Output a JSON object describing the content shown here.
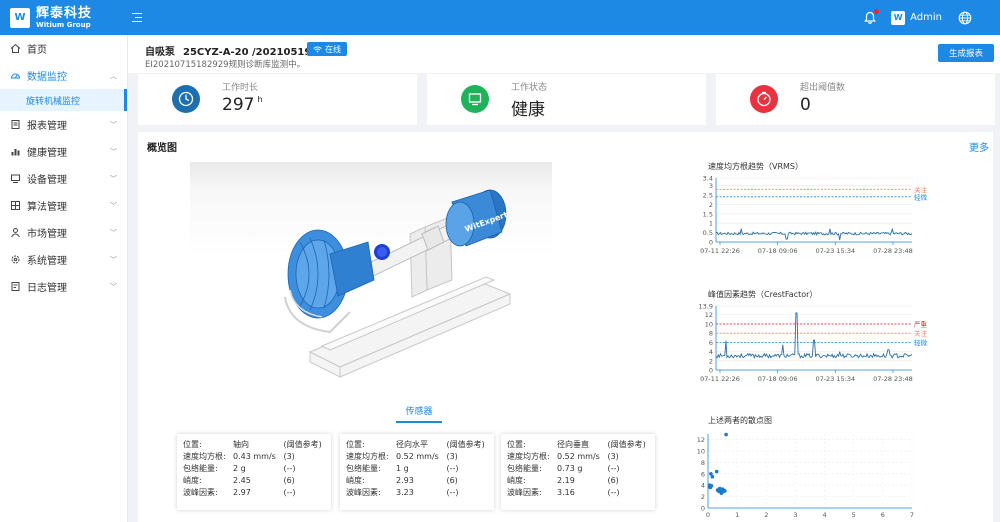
{
  "header": {
    "logo_mark": "W",
    "logo_cn": "辉泰科技",
    "logo_en": "Witium Group",
    "avatar_letter": "W",
    "user_name": "Admin"
  },
  "sidebar": {
    "items": [
      {
        "label": "首页",
        "icon": "home-icon"
      },
      {
        "label": "数据监控",
        "icon": "dashboard-icon",
        "open": true
      },
      {
        "label": "报表管理",
        "icon": "report-icon"
      },
      {
        "label": "健康管理",
        "icon": "bar-chart-icon"
      },
      {
        "label": "设备管理",
        "icon": "device-icon"
      },
      {
        "label": "算法管理",
        "icon": "algorithm-icon"
      },
      {
        "label": "市场管理",
        "icon": "market-icon"
      },
      {
        "label": "系统管理",
        "icon": "settings-icon"
      },
      {
        "label": "日志管理",
        "icon": "log-icon"
      }
    ],
    "sub_item": "旋转机械监控"
  },
  "device": {
    "name": "自吸泵",
    "id": "25CYZ-A-20 /20210519",
    "status": "在线",
    "description": "EI20210715182929规则诊断库监测中。",
    "report_button": "生成报表"
  },
  "stats": [
    {
      "label": "工作时长",
      "value": "297",
      "unit": "h",
      "color": "#1e6fb0",
      "icon": "clock-icon"
    },
    {
      "label": "工作状态",
      "value": "健康",
      "unit": "",
      "color": "#1fb25a",
      "icon": "monitor-icon"
    },
    {
      "label": "超出阈值数",
      "value": "0",
      "unit": "",
      "color": "#e8323f",
      "icon": "timer-icon"
    }
  ],
  "overview": {
    "title": "概览图",
    "more": "更多",
    "sensor_tab": "传感器",
    "model_label": "WitExpert"
  },
  "sensors": [
    {
      "rows": [
        [
          "位置:",
          "轴向",
          "(阈值参考)"
        ],
        [
          "速度均方根:",
          "0.43 mm/s",
          "(3)"
        ],
        [
          "包络能量:",
          "2 g",
          "(--)"
        ],
        [
          "峭度:",
          "2.45",
          "(6)"
        ],
        [
          "波峰因素:",
          "2.97",
          "(--)"
        ]
      ]
    },
    {
      "rows": [
        [
          "位置:",
          "径向水平",
          "(阈值参考)"
        ],
        [
          "速度均方根:",
          "0.52 mm/s",
          "(3)"
        ],
        [
          "包络能量:",
          "1 g",
          "(--)"
        ],
        [
          "峭度:",
          "2.93",
          "(6)"
        ],
        [
          "波峰因素:",
          "3.23",
          "(--)"
        ]
      ]
    },
    {
      "rows": [
        [
          "位置:",
          "径向垂直",
          "(阈值参考)"
        ],
        [
          "速度均方根:",
          "0.52 mm/s",
          "(3)"
        ],
        [
          "包络能量:",
          "0.73 g",
          "(--)"
        ],
        [
          "峭度:",
          "2.19",
          "(6)"
        ],
        [
          "波峰因素:",
          "3.16",
          "(--)"
        ]
      ]
    }
  ],
  "chart_data": [
    {
      "type": "line",
      "title": "速度均方根趋势（VRMS）",
      "yticks": [
        0,
        0.5,
        1,
        1.5,
        2,
        2.5,
        3,
        3.4
      ],
      "ylim": [
        0,
        3.4
      ],
      "xticks": [
        "07-11 22:26",
        "07-18 09:06",
        "07-23 15:34",
        "07-28 23:48"
      ],
      "thresholds": [
        {
          "label": "关注",
          "value": 2.8,
          "color": "#f4845f"
        },
        {
          "label": "轻微",
          "value": 2.4,
          "color": "#1e88e5"
        }
      ],
      "series": [
        {
          "baseline": 0.45,
          "noise": 0.07,
          "spikes": [
            [
              0.13,
              0.7
            ],
            [
              0.36,
              0.15
            ],
            [
              0.58,
              0.7
            ],
            [
              0.63,
              0.1
            ],
            [
              0.9,
              0.68
            ]
          ]
        }
      ]
    },
    {
      "type": "line",
      "title": "峰值因素趋势（CrestFactor）",
      "yticks": [
        0,
        2,
        4,
        6,
        8,
        10,
        12,
        13.9
      ],
      "ylim": [
        0,
        13.9
      ],
      "xticks": [
        "07-11 22:26",
        "07-18 09:06",
        "07-23 15:34",
        "07-28 23:48"
      ],
      "thresholds": [
        {
          "label": "严重",
          "value": 10,
          "color": "#e8323f"
        },
        {
          "label": "关注",
          "value": 8,
          "color": "#f4845f"
        },
        {
          "label": "轻微",
          "value": 6,
          "color": "#1e88e5"
        }
      ],
      "series": [
        {
          "baseline": 3.1,
          "noise": 0.45,
          "spikes": [
            [
              0.05,
              6.4
            ],
            [
              0.34,
              5.5
            ],
            [
              0.41,
              12.4
            ],
            [
              0.5,
              6.5
            ],
            [
              0.63,
              4.0
            ],
            [
              0.88,
              4.4
            ]
          ]
        }
      ]
    },
    {
      "type": "scatter",
      "title": "上述两者的散点图",
      "xticks": [
        0,
        1,
        2,
        3,
        4,
        5,
        6,
        7
      ],
      "yticks": [
        0,
        2,
        4,
        6,
        8,
        10,
        12
      ],
      "xlim": [
        0,
        7
      ],
      "ylim": [
        0,
        13
      ],
      "points": [
        [
          0.45,
          3.1
        ],
        [
          0.38,
          2.9
        ],
        [
          0.5,
          3.3
        ],
        [
          0.42,
          3.0
        ],
        [
          0.47,
          2.7
        ],
        [
          0.4,
          3.4
        ],
        [
          0.52,
          2.95
        ],
        [
          0.44,
          3.2
        ],
        [
          0.36,
          3.05
        ],
        [
          0.49,
          2.85
        ],
        [
          0.41,
          3.35
        ],
        [
          0.55,
          3.1
        ],
        [
          0.33,
          3.15
        ],
        [
          0.46,
          2.6
        ],
        [
          0.58,
          3.0
        ],
        [
          0.05,
          3.8
        ],
        [
          0.06,
          4.0
        ],
        [
          0.08,
          3.6
        ],
        [
          0.12,
          3.9
        ],
        [
          0.3,
          6.4
        ],
        [
          0.1,
          6.0
        ],
        [
          0.15,
          5.5
        ],
        [
          0.62,
          12.9
        ]
      ]
    }
  ]
}
